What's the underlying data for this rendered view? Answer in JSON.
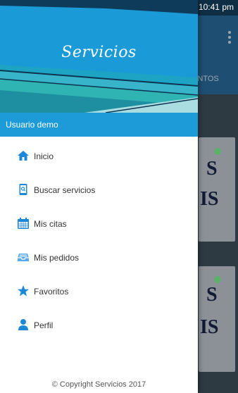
{
  "status_bar": {
    "time": "10:41 pm"
  },
  "background_app": {
    "tab_label": "IENTOS",
    "card_texts": [
      "S",
      "IS",
      "S",
      "IS"
    ]
  },
  "drawer": {
    "logo_text": "Servicios",
    "user_name": "Usuario demo",
    "menu": [
      {
        "label": "Inicio",
        "icon": "home-icon"
      },
      {
        "label": "Buscar servicios",
        "icon": "search-device-icon"
      },
      {
        "label": "Mis citas",
        "icon": "calendar-icon"
      },
      {
        "label": "Mis pedidos",
        "icon": "inbox-tray-icon"
      },
      {
        "label": "Favoritos",
        "icon": "star-icon"
      },
      {
        "label": "Perfil",
        "icon": "person-icon"
      }
    ],
    "footer": "© Copyright Servicios 2017"
  },
  "colors": {
    "accent": "#1d9bd8",
    "icon_blue": "#1e88d8",
    "status_bar": "#0f2e44"
  }
}
